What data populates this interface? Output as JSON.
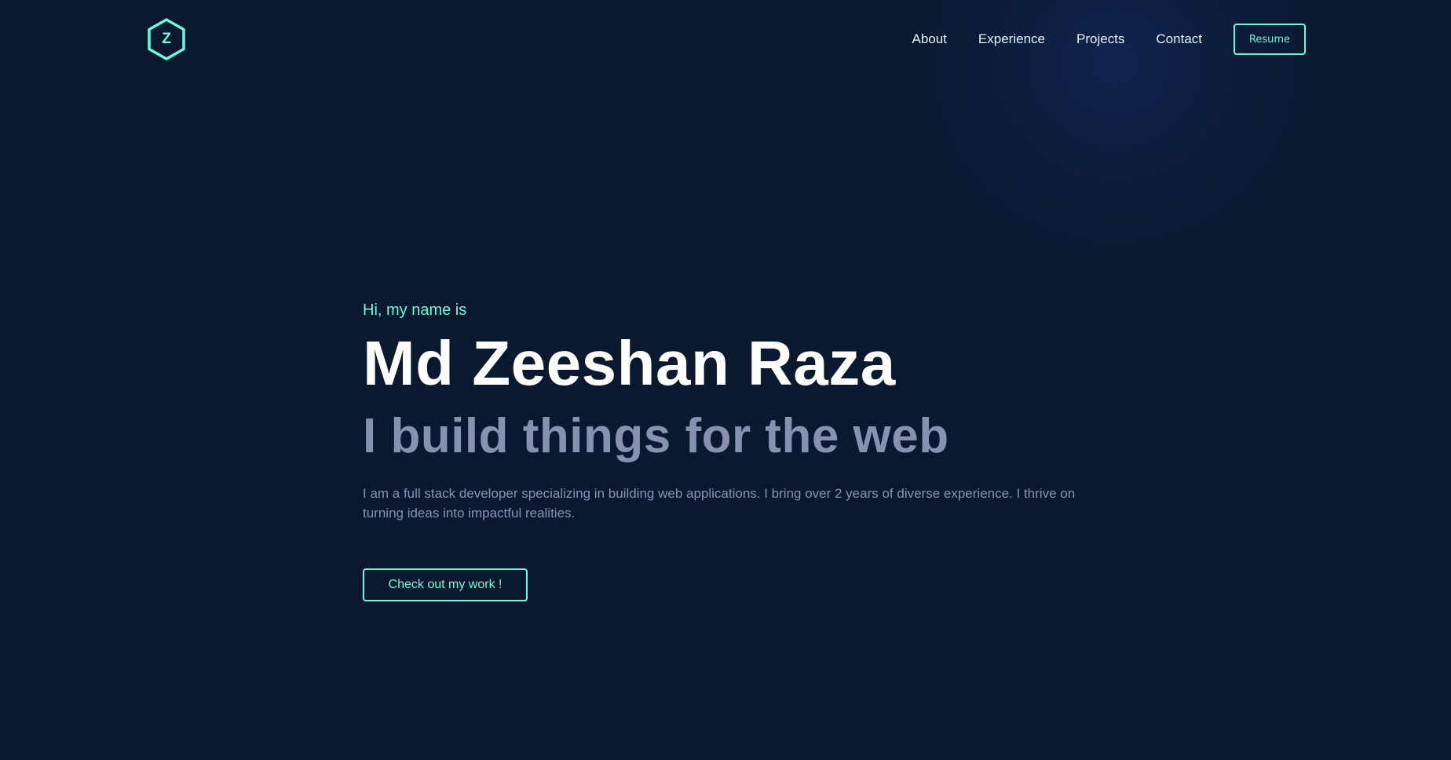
{
  "logo": {
    "letter": "Z",
    "icon": "hexagon-icon",
    "accent": "#64ffda"
  },
  "nav": {
    "items": [
      {
        "label": "About"
      },
      {
        "label": "Experience"
      },
      {
        "label": "Projects"
      },
      {
        "label": "Contact"
      }
    ],
    "resume_label": "Resume"
  },
  "hero": {
    "greeting": "Hi, my name is",
    "name": "Md Zeeshan Raza",
    "tagline": "I build things for the web",
    "description": "I am a full stack developer specializing in building web applications. I bring over 2 years of diverse experience. I thrive on turning ideas into impactful realities.",
    "cta_label": "Check out my work !"
  },
  "colors": {
    "background": "#0b1930",
    "accent": "#64ffda",
    "heading": "#ffffff",
    "muted": "#8892b0",
    "nav_text": "#e6f1ff"
  }
}
